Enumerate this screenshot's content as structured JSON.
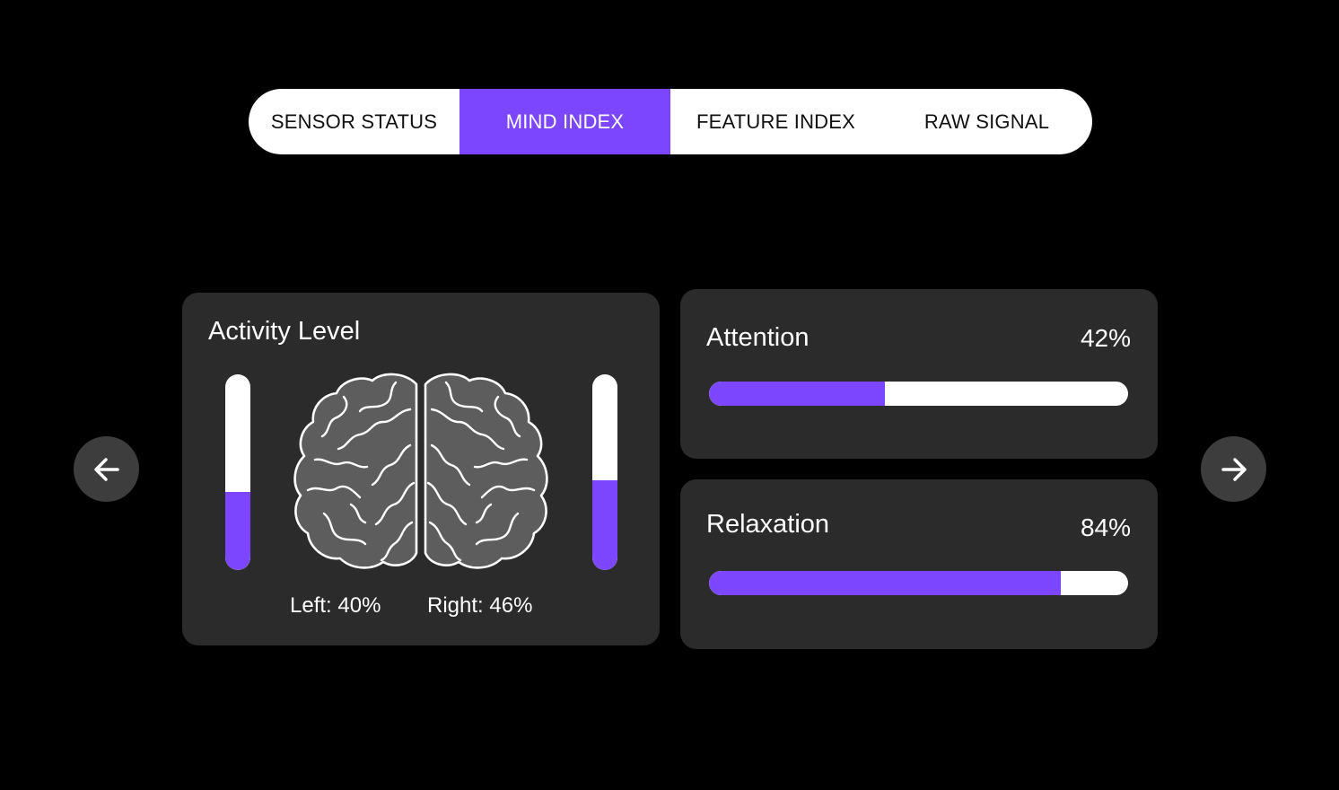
{
  "colors": {
    "accent": "#7c46ff",
    "card_bg": "#2b2b2b",
    "button_bg": "#3d3d3d"
  },
  "tabs": [
    {
      "label": "SENSOR STATUS",
      "active": false
    },
    {
      "label": "MIND INDEX",
      "active": true
    },
    {
      "label": "FEATURE INDEX",
      "active": false
    },
    {
      "label": "RAW SIGNAL",
      "active": false
    }
  ],
  "nav": {
    "prev_icon": "arrow-left-icon",
    "next_icon": "arrow-right-icon"
  },
  "activity": {
    "title": "Activity Level",
    "icon": "brain-icon",
    "left": {
      "label": "Left:",
      "value_text": "40%",
      "level": 0.4
    },
    "right": {
      "label": "Right:",
      "value_text": "46%",
      "level": 0.46
    }
  },
  "attention": {
    "title": "Attention",
    "value_text": "42%",
    "level": 0.42
  },
  "relaxation": {
    "title": "Relaxation",
    "value_text": "84%",
    "level": 0.84
  }
}
